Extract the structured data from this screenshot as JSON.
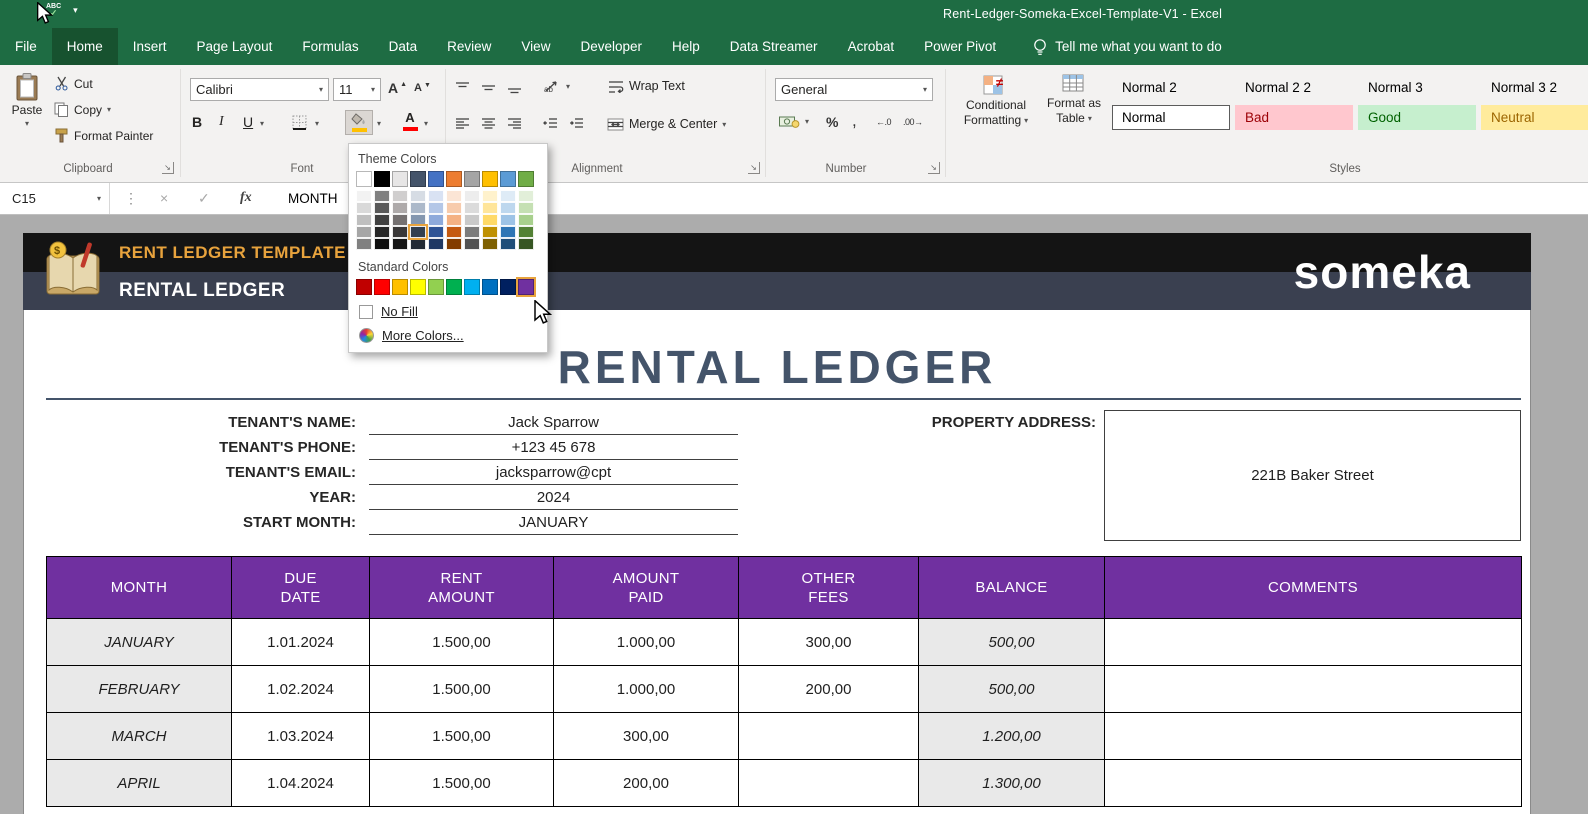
{
  "titlebar": {
    "title": "Rent-Ledger-Someka-Excel-Template-V1 - Excel"
  },
  "tabs": [
    {
      "label": "File",
      "active": false
    },
    {
      "label": "Home",
      "active": true
    },
    {
      "label": "Insert",
      "active": false
    },
    {
      "label": "Page Layout",
      "active": false
    },
    {
      "label": "Formulas",
      "active": false
    },
    {
      "label": "Data",
      "active": false
    },
    {
      "label": "Review",
      "active": false
    },
    {
      "label": "View",
      "active": false
    },
    {
      "label": "Developer",
      "active": false
    },
    {
      "label": "Help",
      "active": false
    },
    {
      "label": "Data Streamer",
      "active": false
    },
    {
      "label": "Acrobat",
      "active": false
    },
    {
      "label": "Power Pivot",
      "active": false
    }
  ],
  "tell_me": "Tell me what you want to do",
  "icons": {
    "caret": "▾",
    "up": "▲",
    "down": "▼",
    "check": "✓",
    "cancel": "×",
    "dots": "⋮",
    "launcher": "↘",
    "bold": "B",
    "italic": "I",
    "underline": "U",
    "percent": "%",
    "comma": ",",
    "inc_decimal": "←.0",
    "dec_decimal": ".00→",
    "grow_font": "A",
    "shrink_font": "A",
    "spell_abc": "ABC",
    "spell_check": "✓",
    "font_color_letter": "A"
  },
  "ribbon": {
    "clipboard": {
      "group": "Clipboard",
      "paste": "Paste",
      "cut": "Cut",
      "copy": "Copy",
      "format_painter": "Format Painter"
    },
    "font": {
      "group": "Font",
      "name": "Calibri",
      "size": "11",
      "fill_indicator": "#FFC000",
      "font_color_indicator": "#FF0000"
    },
    "alignment": {
      "group": "Alignment",
      "wrap": "Wrap Text",
      "merge": "Merge & Center"
    },
    "number": {
      "group": "Number",
      "format": "General"
    },
    "styles": {
      "group": "Styles",
      "conditional": [
        "Conditional",
        "Formatting"
      ],
      "format_table": [
        "Format as",
        "Table"
      ],
      "gallery": [
        {
          "label": "Normal 2",
          "bg": "",
          "fg": "#000000",
          "selected": false
        },
        {
          "label": "Normal 2 2",
          "bg": "",
          "fg": "#000000",
          "selected": false
        },
        {
          "label": "Normal 3",
          "bg": "",
          "fg": "#000000",
          "selected": false
        },
        {
          "label": "Normal 3 2",
          "bg": "",
          "fg": "#000000",
          "selected": false
        },
        {
          "label": "Normal",
          "bg": "#FFFFFF",
          "fg": "#000000",
          "selected": true
        },
        {
          "label": "Bad",
          "bg": "#FFC7CE",
          "fg": "#9C0006",
          "selected": false
        },
        {
          "label": "Good",
          "bg": "#C6EFCE",
          "fg": "#006100",
          "selected": false
        },
        {
          "label": "Neutral",
          "bg": "#FFEB9C",
          "fg": "#9C6500",
          "selected": false
        }
      ]
    }
  },
  "formula_bar": {
    "name_box": "C15",
    "fx": "fx",
    "content": "MONTH"
  },
  "color_picker": {
    "theme_title": "Theme Colors",
    "standard_title": "Standard Colors",
    "no_fill": "No Fill",
    "more_colors": "More Colors...",
    "highlight_color": "#E8A33D",
    "theme_colors": [
      "#FFFFFF",
      "#000000",
      "#E7E6E6",
      "#44546A",
      "#4472C4",
      "#ED7D31",
      "#A5A5A5",
      "#FFC000",
      "#5B9BD5",
      "#70AD47"
    ],
    "theme_variants": [
      [
        "#F2F2F2",
        "#808080",
        "#D0CECE",
        "#D6DCE4",
        "#D9E2F3",
        "#FBE5D5",
        "#EDEDED",
        "#FFF2CC",
        "#DEEBF6",
        "#E2EFD9"
      ],
      [
        "#D9D9D9",
        "#595959",
        "#AEAAAA",
        "#ACB9CA",
        "#B4C7E7",
        "#F7CBAC",
        "#DBDBDB",
        "#FFE599",
        "#BDD7EE",
        "#C5E0B3"
      ],
      [
        "#BFBFBF",
        "#404040",
        "#757171",
        "#8497B0",
        "#8EAADB",
        "#F4B183",
        "#C9C9C9",
        "#FFD966",
        "#9DC3E6",
        "#A8D08D"
      ],
      [
        "#A6A6A6",
        "#262626",
        "#3A3838",
        "#333F50",
        "#2F5496",
        "#C55A11",
        "#7B7B7B",
        "#BF9000",
        "#2E75B5",
        "#538135"
      ],
      [
        "#808080",
        "#0D0D0D",
        "#171717",
        "#222A35",
        "#1F3864",
        "#833C00",
        "#525252",
        "#7F6000",
        "#1F4E79",
        "#375623"
      ]
    ],
    "standard_colors": [
      "#C00000",
      "#FF0000",
      "#FFC000",
      "#FFFF00",
      "#92D050",
      "#00B050",
      "#00B0F0",
      "#0070C0",
      "#002060",
      "#7030A0"
    ],
    "highlighted_variant": {
      "row": 3,
      "col": 3
    },
    "highlighted_standard": 9
  },
  "banner": {
    "kicker": "RENT LEDGER TEMPLATE",
    "title": "RENTAL LEDGER",
    "logo": "someka",
    "kicker_color": "#E8A33D",
    "bg_top": "#141414",
    "bg_bottom": "#3A4050"
  },
  "sheet": {
    "title": "RENTAL LEDGER",
    "accent": "#44546A",
    "fields": [
      {
        "label": "TENANT'S NAME:",
        "value": "Jack Sparrow"
      },
      {
        "label": "TENANT'S PHONE:",
        "value": "+123 45 678"
      },
      {
        "label": "TENANT'S EMAIL:",
        "value": "jacksparrow@cpt"
      },
      {
        "label": "YEAR:",
        "value": "2024"
      },
      {
        "label": "START MONTH:",
        "value": "JANUARY"
      }
    ],
    "property_label": "PROPERTY ADDRESS:",
    "property_value": "221B Baker Street",
    "table": {
      "header_color": "#7030A0",
      "headers": [
        [
          "MONTH"
        ],
        [
          "DUE",
          "DATE"
        ],
        [
          "RENT",
          "AMOUNT"
        ],
        [
          "AMOUNT",
          "PAID"
        ],
        [
          "OTHER",
          "FEES"
        ],
        [
          "BALANCE"
        ],
        [
          "COMMENTS"
        ]
      ],
      "rows": [
        [
          "JANUARY",
          "1.01.2024",
          "1.500,00",
          "1.000,00",
          "300,00",
          "500,00",
          ""
        ],
        [
          "FEBRUARY",
          "1.02.2024",
          "1.500,00",
          "1.000,00",
          "200,00",
          "500,00",
          ""
        ],
        [
          "MARCH",
          "1.03.2024",
          "1.500,00",
          "300,00",
          "",
          "1.200,00",
          ""
        ],
        [
          "APRIL",
          "1.04.2024",
          "1.500,00",
          "200,00",
          "",
          "1.300,00",
          ""
        ]
      ]
    }
  }
}
